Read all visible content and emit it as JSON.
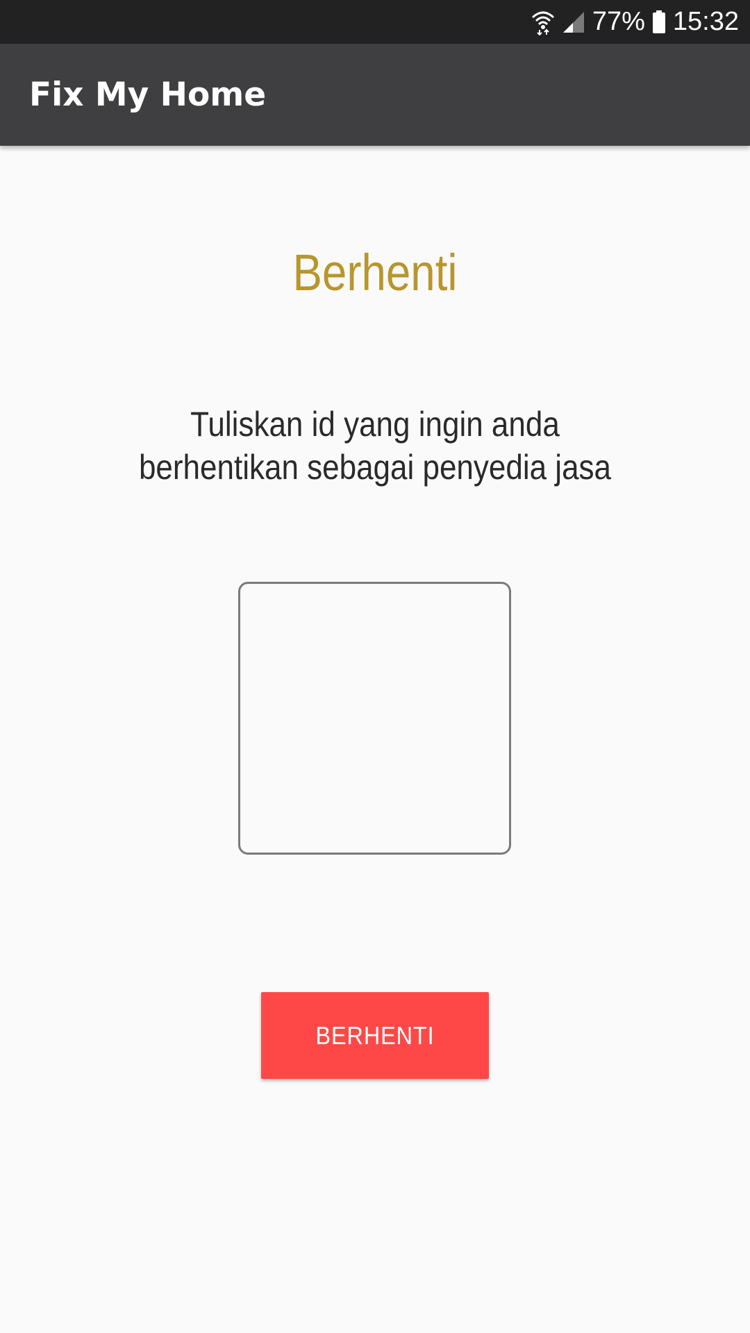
{
  "status_bar": {
    "battery_percent": "77%",
    "time": "15:32",
    "icons": [
      "wifi-icon",
      "signal-icon",
      "battery-icon"
    ]
  },
  "app_bar": {
    "title": "Fix My Home"
  },
  "main": {
    "heading": "Berhenti",
    "instruction_line1": "Tuliskan id yang ingin anda",
    "instruction_line2": "berhentikan sebagai penyedia jasa",
    "id_input": {
      "value": "",
      "placeholder": ""
    },
    "stop_button_label": "BERHENTI"
  },
  "colors": {
    "status_bar_bg": "#222223",
    "app_bar_bg": "#3f3f41",
    "heading_color": "#b8962e",
    "button_bg": "#fe4848",
    "page_bg": "#fafafa"
  }
}
